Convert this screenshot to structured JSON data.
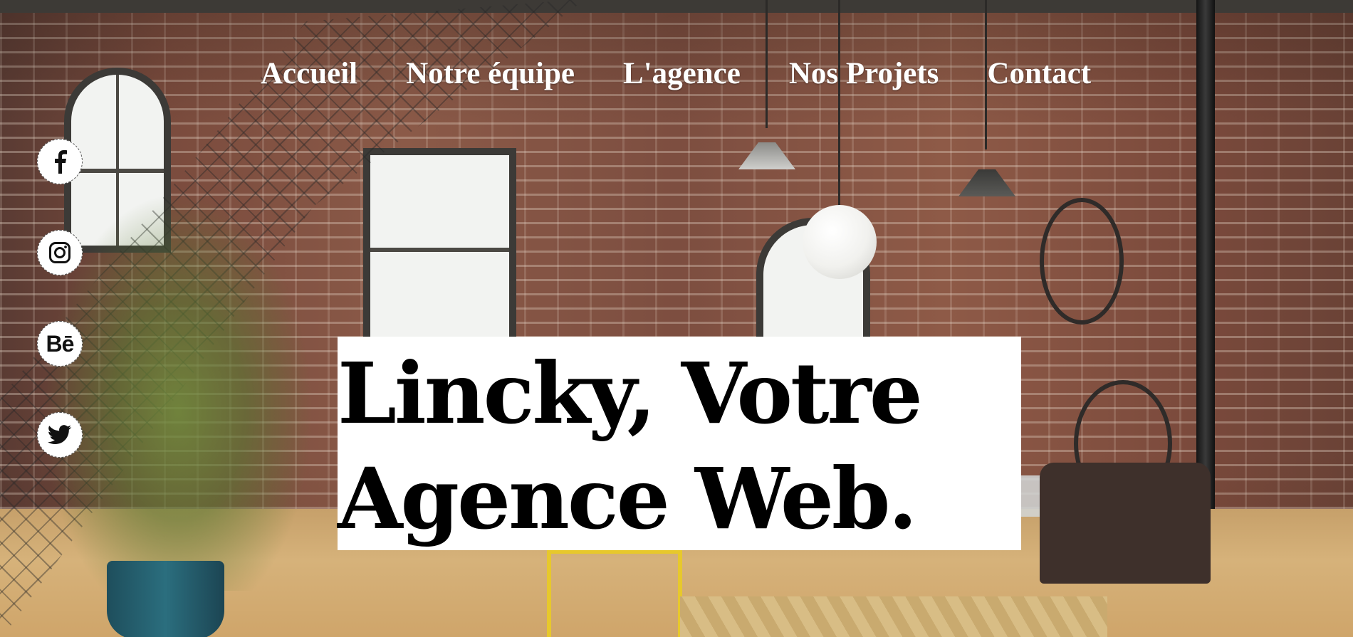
{
  "nav": {
    "items": [
      {
        "label": "Accueil"
      },
      {
        "label": "Notre équipe"
      },
      {
        "label": "L'agence"
      },
      {
        "label": "Nos Projets"
      },
      {
        "label": "Contact"
      }
    ]
  },
  "social": {
    "items": [
      {
        "icon": "facebook-icon"
      },
      {
        "icon": "instagram-icon"
      },
      {
        "icon": "behance-icon",
        "glyph": "Bē"
      },
      {
        "icon": "twitter-icon"
      }
    ]
  },
  "hero": {
    "headline_line1": "Lincky, Votre",
    "headline_line2": "Agence Web."
  },
  "colors": {
    "nav_text": "#ffffff",
    "headline_text": "#000000",
    "headline_bg": "#ffffff",
    "social_bg": "#ffffff"
  }
}
